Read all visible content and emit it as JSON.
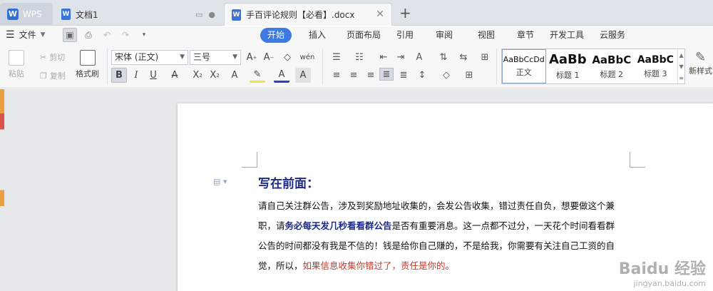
{
  "tabs": {
    "wps": "WPS",
    "doc1": "文档1",
    "active": "手百评论规则【必看】.docx"
  },
  "menu": {
    "file": "文件",
    "ribbon_tabs": [
      "开始",
      "插入",
      "页面布局",
      "引用",
      "审阅",
      "视图",
      "章节",
      "开发工具",
      "云服务"
    ]
  },
  "ribbon": {
    "paste": "粘贴",
    "cut": "剪切",
    "copy": "复制",
    "format_painter": "格式刷",
    "font_name": "宋体 (正文)",
    "font_size": "三号",
    "styles": [
      {
        "sample": "AaBbCcDd",
        "name": "正文"
      },
      {
        "sample": "AaBb",
        "name": "标题 1"
      },
      {
        "sample": "AaBbC",
        "name": "标题 2"
      },
      {
        "sample": "AaBbC",
        "name": "标题 3"
      }
    ],
    "new_style": "新样式"
  },
  "document": {
    "heading": "写在前面：",
    "p1": "请自己关注群公告，涉及到奖励地址收集的，会发公告收集，错过责任自负，想要做这个兼",
    "p2_pre": "职，请",
    "p2_bold": "务必每天发几秒看看群公告",
    "p2_post": "是否有重要消息。这一点都不过分，一天花个时间看看群",
    "p3": "公告的时间都没有我是不信的！钱是给你自己赚的，不是给我，你需要有关注自己工资的自",
    "p4_pre": "觉，所以，",
    "p4_red": "如果信息收集你错过了，责任是你的。"
  },
  "watermark": {
    "big": "Baidu 经验",
    "small": "jingyan.baidu.com"
  }
}
